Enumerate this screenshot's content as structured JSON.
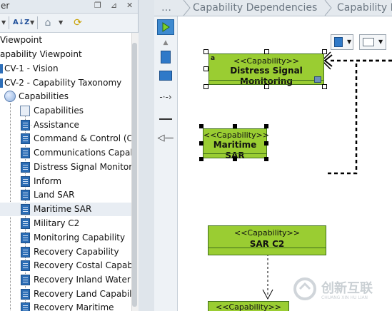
{
  "left_panel": {
    "title": "er",
    "tree": [
      {
        "label": "Viewpoint"
      },
      {
        "label": "apability Viewpoint"
      },
      {
        "label": "CV-1 - Vision"
      },
      {
        "label": "CV-2 - Capability Taxonomy"
      },
      {
        "label": "Capabilities"
      },
      {
        "label": "Capabilities"
      },
      {
        "label": "Assistance"
      },
      {
        "label": "Command & Control (CS)"
      },
      {
        "label": "Communications Capability"
      },
      {
        "label": "Distress Signal Monitoring"
      },
      {
        "label": "Inform"
      },
      {
        "label": "Land SAR"
      },
      {
        "label": "Maritime SAR"
      },
      {
        "label": "Military C2"
      },
      {
        "label": "Monitoring Capability"
      },
      {
        "label": "Recovery Capability"
      },
      {
        "label": "Recovery Costal Capability"
      },
      {
        "label": "Recovery Inland Water"
      },
      {
        "label": "Recovery Land Capability"
      },
      {
        "label": "Recovery Maritime"
      }
    ],
    "toolbar_icons": [
      "dropdown-arrow-icon",
      "sort-az-icon",
      "home-icon",
      "refresh-icon"
    ]
  },
  "breadcrumb": {
    "ellipsis": "…",
    "items": [
      "Capability Dependencies",
      "Capability L"
    ]
  },
  "palette": [
    "select-pointer-icon",
    "triangle-up-icon",
    "capability-icon",
    "capability-box-icon",
    "dependency-arrow-icon",
    "line-tool-icon",
    "triangle-arrow-icon"
  ],
  "diagram": {
    "stereotype": "<<Capability>>",
    "nodes": [
      {
        "stereotype": "<<Capability>>",
        "name": "Distress Signal Monitoring",
        "badge": "a"
      },
      {
        "stereotype": "<<Capability>>",
        "name": "Maritime SAR"
      },
      {
        "stereotype": "<<Capability>>",
        "name": "SAR C2"
      },
      {
        "stereotype": "<<Capability>>",
        "name": ""
      }
    ]
  },
  "watermark": {
    "text": "创新互联",
    "subtext": "CHUANG XIN HU LIAN"
  },
  "colors": {
    "capability_fill": "#9acd32",
    "capability_border": "#3f6f1a",
    "tree_icon": "#2c6db5",
    "canvas": "#ffffff"
  }
}
